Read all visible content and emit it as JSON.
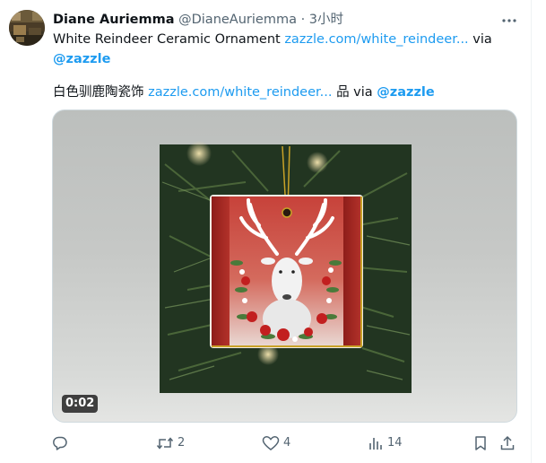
{
  "author": {
    "display_name": "Diane Auriemma",
    "handle": "@DianeAuriemma",
    "separator": "·",
    "time": "3小时"
  },
  "tweet": {
    "line1_text": "White Reindeer Ceramic Ornament ",
    "line1_link": "zazzle.com/white_reindeer...",
    "line1_via": " via",
    "line1_mention": "@zazzle",
    "line2_text": "白色驯鹿陶瓷饰 ",
    "line2_link": "zazzle.com/white_reindeer...",
    "line2_suffix": " 品 via ",
    "line2_mention": "@zazzle"
  },
  "media": {
    "duration": "0:02"
  },
  "actions": {
    "reply_count": "",
    "retweet_count": "2",
    "like_count": "4",
    "views_count": "14"
  },
  "icons": {
    "more": "more-icon",
    "reply": "reply-icon",
    "retweet": "retweet-icon",
    "like": "heart-icon",
    "views": "analytics-icon",
    "bookmark": "bookmark-icon",
    "share": "share-icon"
  },
  "colors": {
    "link": "#1d9bf0",
    "secondary_text": "#536471",
    "primary_text": "#0f1419",
    "border": "#cfd9de"
  }
}
